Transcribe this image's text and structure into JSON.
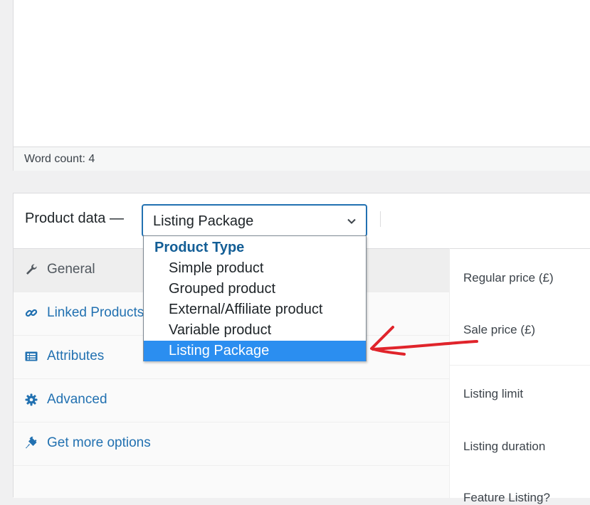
{
  "editor": {
    "word_count": "Word count: 4"
  },
  "product_data": {
    "title": "Product data —",
    "selected_type": "Listing Package",
    "dropdown": {
      "group_label": "Product Type",
      "options": [
        "Simple product",
        "Grouped product",
        "External/Affiliate product",
        "Variable product",
        "Listing Package"
      ],
      "selected": "Listing Package"
    },
    "tabs": [
      {
        "label": "General",
        "icon": "wrench-icon"
      },
      {
        "label": "Linked Products",
        "icon": "link-icon"
      },
      {
        "label": "Attributes",
        "icon": "list-icon"
      },
      {
        "label": "Advanced",
        "icon": "gear-icon"
      },
      {
        "label": "Get more options",
        "icon": "plugin-icon"
      }
    ],
    "fields": {
      "regular_price": "Regular price (£)",
      "sale_price": "Sale price (£)",
      "listing_limit": "Listing limit",
      "listing_duration": "Listing duration",
      "feature_listing": "Feature Listing?"
    }
  },
  "colors": {
    "accent": "#2271b1",
    "highlight": "#2b8ef0",
    "annotation": "#e0242b"
  }
}
